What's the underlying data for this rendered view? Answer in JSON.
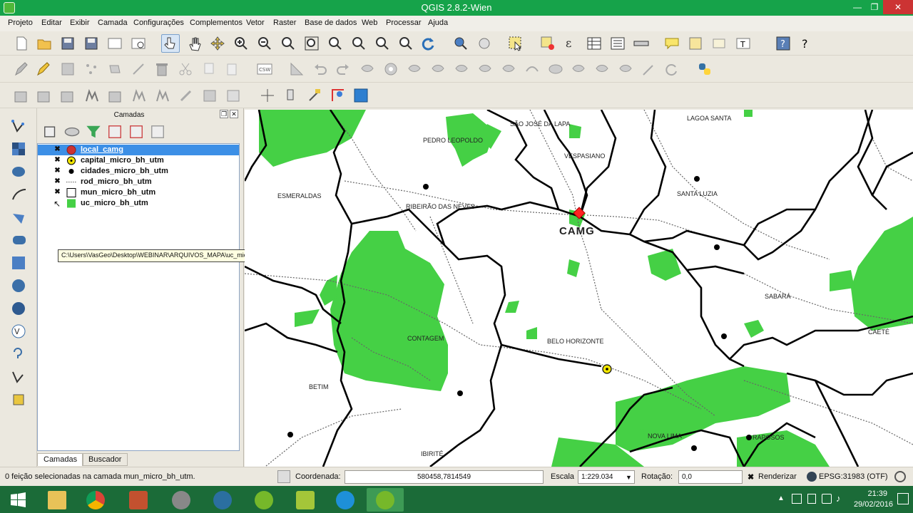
{
  "window": {
    "title": "QGIS 2.8.2-Wien",
    "minimize_glyph": "—",
    "maximize_glyph": "❐",
    "close_glyph": "✕"
  },
  "menu": {
    "items": [
      "Projeto",
      "Editar",
      "Exibir",
      "Camada",
      "Configurações",
      "Complementos",
      "Vetor",
      "Raster",
      "Base de dados",
      "Web",
      "Processar",
      "Ajuda"
    ]
  },
  "layers_panel": {
    "title": "Camadas",
    "layers": [
      {
        "name": "local_camg",
        "checked": "✖",
        "symbol": "red-circle",
        "color": "#cc3333",
        "selected": true
      },
      {
        "name": "capital_micro_bh_utm",
        "checked": "✖",
        "symbol": "yellow-point",
        "color": "#f2e600",
        "selected": false
      },
      {
        "name": "cidades_micro_bh_utm",
        "checked": "✖",
        "symbol": "black-point",
        "color": "#000000",
        "selected": false
      },
      {
        "name": "rod_micro_bh_utm",
        "checked": "✖",
        "symbol": "dotted-line",
        "color": "#555555",
        "selected": false
      },
      {
        "name": "mun_micro_bh_utm",
        "checked": "✖",
        "symbol": "white-polygon",
        "color": "#ffffff",
        "selected": false
      },
      {
        "name": "uc_micro_bh_utm",
        "checked": "",
        "symbol": "green-polygon",
        "color": "#45d045",
        "selected": false
      }
    ],
    "tooltip": "C:\\Users\\VasGeo\\Desktop\\WEBINAR\\ARQUIVOS_MAPA\\uc_micro_bh_utm.shp",
    "tabs": [
      "Camadas",
      "Buscador"
    ]
  },
  "map": {
    "places": [
      {
        "name": "LAGOA SANTA"
      },
      {
        "name": "SÃO JOSÉ DA LAPA"
      },
      {
        "name": "PEDRO LEOPOLDO"
      },
      {
        "name": "VESPASIANO"
      },
      {
        "name": "ESMERALDAS"
      },
      {
        "name": "SANTA LUZIA"
      },
      {
        "name": "RIBEIRÃO DAS NEVES"
      },
      {
        "name": "CAMG"
      },
      {
        "name": "SABARÁ"
      },
      {
        "name": "CAETÉ"
      },
      {
        "name": "CONTAGEM"
      },
      {
        "name": "BELO HORIZONTE"
      },
      {
        "name": "BETIM"
      },
      {
        "name": "NOVA LIMA"
      },
      {
        "name": "RAPOSOS"
      },
      {
        "name": "IBIRITÉ"
      }
    ],
    "colors": {
      "protected_area": "#45d045",
      "boundary": "#000000",
      "roads": "#666666",
      "camg_marker": "#ff2222"
    }
  },
  "status": {
    "message": "0 feição selecionadas na camada mun_micro_bh_utm.",
    "coord_label": "Coordenada:",
    "coord_value": "580458,7814549",
    "scale_label": "Escala",
    "scale_value": "1:229.034",
    "rotation_label": "Rotação:",
    "rotation_value": "0,0",
    "render_label": "Renderizar",
    "crs": "EPSG:31983 (OTF)"
  },
  "taskbar": {
    "time": "21:39",
    "date": "29/02/2016"
  }
}
